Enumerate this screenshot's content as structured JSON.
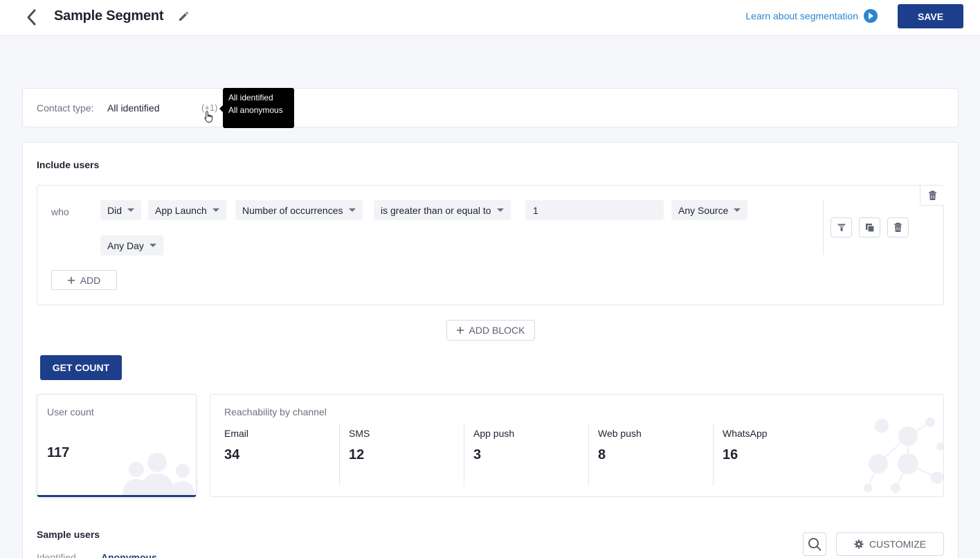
{
  "header": {
    "title": "Sample Segment",
    "learn_link": "Learn about segmentation",
    "save_label": "SAVE"
  },
  "contact": {
    "label": "Contact type:",
    "value": "All identified",
    "more": "(+1)",
    "tooltip": [
      "All identified",
      "All anonymous"
    ]
  },
  "include": {
    "title": "Include users",
    "who": "who",
    "did": "Did",
    "event": "App Launch",
    "metric": "Number of occurrences",
    "operator": "is greater than or equal to",
    "value": "1",
    "source": "Any Source",
    "day": "Any Day",
    "add_label": "ADD",
    "add_block_label": "ADD BLOCK",
    "get_count_label": "GET COUNT"
  },
  "counts": {
    "user_count_label": "User count",
    "user_count_value": "117",
    "reach_title": "Reachability by channel",
    "channels": [
      {
        "name": "Email",
        "value": "34"
      },
      {
        "name": "SMS",
        "value": "12"
      },
      {
        "name": "App push",
        "value": "3"
      },
      {
        "name": "Web push",
        "value": "8"
      },
      {
        "name": "WhatsApp",
        "value": "16"
      }
    ]
  },
  "sample": {
    "title": "Sample users",
    "customize_label": "CUSTOMIZE",
    "tabs": [
      "Identified",
      "Anonymous"
    ]
  },
  "colors": {
    "primary": "#1d3e8a",
    "link": "#2a86d1"
  }
}
